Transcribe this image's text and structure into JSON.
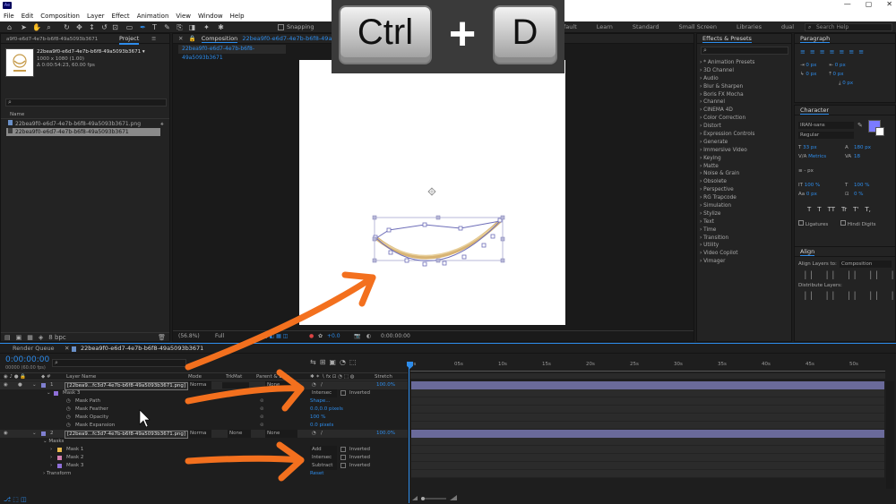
{
  "window": {
    "app_badge": "Ae",
    "controls": [
      "—",
      "▢",
      "✕"
    ]
  },
  "menu": [
    "File",
    "Edit",
    "Composition",
    "Layer",
    "Effect",
    "Animation",
    "View",
    "Window",
    "Help"
  ],
  "toolbar": {
    "snapping_label": "Snapping",
    "workspaces": [
      "Default",
      "Learn",
      "Standard",
      "Small Screen",
      "Libraries",
      "dual"
    ],
    "search_placeholder": "Search Help"
  },
  "shortcut_overlay": {
    "key1": "Ctrl",
    "plus": "+",
    "key2": "D"
  },
  "project": {
    "panel_title": "Project",
    "file_title": "a9f0-e6d7-4e7b-b6f8-49a5093b3671",
    "thumb_name": "22bea9f0-e6d7-4e7b-b6f8-49a5093b3671 ▾",
    "thumb_info1": "1000 x 1080 (1.00)",
    "thumb_info2": "Δ 0:00:54:23, 60.00 fps",
    "name_header": "Name",
    "items": [
      "22bea9f0-e6d7-4e7b-b6f8-49a5093b3671.png",
      "22bea9f0-e6d7-4e7b-b6f8-49a5093b3671"
    ],
    "footer_bpc": "8 bpc"
  },
  "comp": {
    "panel_title": "Composition",
    "comp_name": "22bea9f0-e6d7-4e7b-b6f8-49a5093b3671",
    "tab_label": "22bea9f0-e6d7-4e7b-b6f8-49a5093b3671",
    "zoom": "(56.8%)",
    "quality": "Full",
    "exposure": "+0.0",
    "time": "0:00:00:00"
  },
  "effects": {
    "panel_title": "Effects & Presets",
    "items": [
      "* Animation Presets",
      "3D Channel",
      "Audio",
      "Blur & Sharpen",
      "Boris FX Mocha",
      "Channel",
      "CINEMA 4D",
      "Color Correction",
      "Distort",
      "Expression Controls",
      "Generate",
      "Immersive Video",
      "Keying",
      "Matte",
      "Noise & Grain",
      "Obsolete",
      "Perspective",
      "RG Trapcode",
      "Simulation",
      "Stylize",
      "Text",
      "Time",
      "Transition",
      "Utility",
      "Video Copilot",
      "Vimager"
    ]
  },
  "paragraph": {
    "title": "Paragraph",
    "values": [
      "0 px",
      "0 px",
      "0 px",
      "0 px",
      "0 px"
    ]
  },
  "character": {
    "title": "Character",
    "font": "IRAN-sans",
    "style": "Regular",
    "size": "33 px",
    "leading": "180 px",
    "kerning": "Metrics",
    "tracking": "18",
    "stroke": "- px",
    "v_scale": "100 %",
    "h_scale": "100 %",
    "baseline": "0 px",
    "tsume": "0 %",
    "styles": [
      "T",
      "T",
      "TT",
      "Tr",
      "T'",
      "T,"
    ],
    "ligatures": "Ligatures",
    "hindi": "Hindi Digits",
    "fill_color": "#7b7bff"
  },
  "align": {
    "title": "Align",
    "align_to_label": "Align Layers to:",
    "align_to_value": "Composition",
    "distribute": "Distribute Layers:"
  },
  "timeline": {
    "render_queue": "Render Queue",
    "tab": "22bea9f0-e6d7-4e7b-b6f8-49a5093b3671",
    "timecode": "0:00:00:00",
    "frames": "00000 (60.00 fps)",
    "columns": {
      "layer_name": "Layer Name",
      "mode": "Mode",
      "trkmat": "TrkMat",
      "parent": "Parent & Link",
      "stretch": "Stretch"
    },
    "ruler": [
      "0s",
      "05s",
      "10s",
      "15s",
      "20s",
      "25s",
      "30s",
      "35s",
      "40s",
      "45s",
      "50s"
    ],
    "layer1": {
      "num": "1",
      "name": "[22bea9...fc3d7-4e7b-b6f8-49a5093b3671.png]",
      "mode": "Norma",
      "parent": "None",
      "stretch": "100.0%"
    },
    "mask3": {
      "name": "Mask 3",
      "mode": "Intersec",
      "inverted": "Inverted",
      "props": [
        {
          "name": "Mask Path",
          "value": "Shape..."
        },
        {
          "name": "Mask Feather",
          "value": "0.0,0.0 pixels"
        },
        {
          "name": "Mask Opacity",
          "value": "100 %"
        },
        {
          "name": "Mask Expansion",
          "value": "0.0 pixels"
        }
      ]
    },
    "layer2": {
      "num": "2",
      "name": "[22bea9...fc3d7-4e7b-b6f8-49a5093b3671.png]",
      "mode": "Norma",
      "trkmat": "None",
      "parent": "None",
      "stretch": "100.0%"
    },
    "masks_group": "Masks",
    "masks": [
      {
        "name": "Mask 1",
        "mode": "Add",
        "inverted": "Inverted",
        "color": "#e8b84a"
      },
      {
        "name": "Mask 2",
        "mode": "Intersec",
        "inverted": "Inverted",
        "color": "#d27fb0"
      },
      {
        "name": "Mask 3",
        "mode": "Subtract",
        "inverted": "Inverted",
        "color": "#8f6fd8"
      }
    ],
    "transform": "Transform",
    "transform_reset": "Reset"
  },
  "colors": {
    "accent": "#2d8ceb",
    "arrow": "#f3701e",
    "mask_path": "#6d6db8",
    "shape_fill": "#d7b374"
  }
}
